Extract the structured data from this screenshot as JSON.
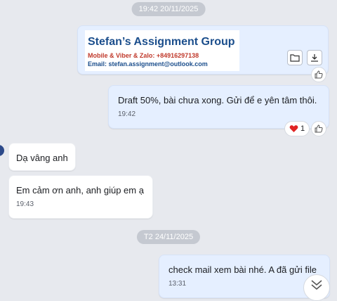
{
  "date_separators": [
    "19:42 20/11/2025",
    "T2 24/11/2025"
  ],
  "file_card": {
    "title": "Stefan’s Assignment Group",
    "line1": "Mobile & Viber & Zalo: +84916297138",
    "line2": "Email: stefan.assignment@outlook.com",
    "folder_icon": "folder-icon",
    "download_icon": "download-icon"
  },
  "messages": [
    {
      "text": "Draft 50%, bài chưa xong. Gửi để e yên tâm thôi.",
      "time": "19:42"
    },
    {
      "text": "Dạ vâng anh"
    },
    {
      "text": "Em cảm ơn anh, anh giúp em ạ",
      "time": "19:43"
    },
    {
      "text": "check mail xem bài nhé. A đã gửi file",
      "time": "13:31"
    }
  ],
  "reaction": {
    "icon": "heart-icon",
    "count": "1"
  },
  "colors": {
    "accent": "#1b4e8c",
    "outgoing_bubble": "#e5efff",
    "heart": "#e02424"
  }
}
